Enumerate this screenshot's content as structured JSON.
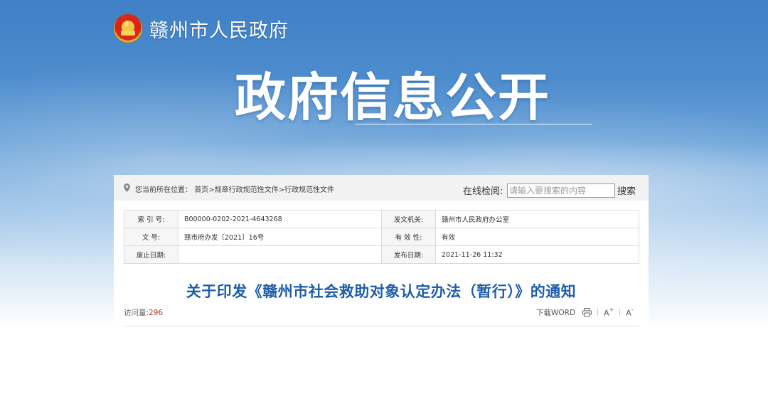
{
  "header": {
    "site_name": "赣州市人民政府",
    "banner_title": "政府信息公开"
  },
  "breadcrumb": {
    "prefix": "您当前所在位置：",
    "items": [
      "首页",
      "规章行政规范性文件",
      "行政规范性文件"
    ],
    "separator": ">"
  },
  "search": {
    "label": "在线检阅:",
    "placeholder": "请输入要搜索的内容",
    "button": "搜索"
  },
  "meta": {
    "index_no_label": "索 引 号:",
    "index_no": "B00000-0202-2021-4643268",
    "issuer_label": "发文机关:",
    "issuer": "赣州市人民政府办公室",
    "doc_no_label": "文    号:",
    "doc_no": "赣市府办发〔2021〕16号",
    "validity_label": "有 效 性:",
    "validity": "有效",
    "expire_label": "废止日期:",
    "expire": "",
    "publish_label": "发布日期:",
    "publish": "2021-11-26 11:32"
  },
  "document": {
    "title": "关于印发《赣州市社会救助对象认定办法（暂行）》的通知",
    "views_label": "访问量:",
    "views_count": "296"
  },
  "toolbar": {
    "download": "下载WORD",
    "font_up": "A",
    "font_up_sign": "+",
    "font_down": "A",
    "font_down_sign": "-"
  },
  "icons": [
    "location-pin-icon",
    "print-icon",
    "emblem-icon"
  ],
  "colors": {
    "banner_blue": "#4d8ccd",
    "title_blue": "#1f5ea8",
    "count_red": "#b0402a"
  }
}
